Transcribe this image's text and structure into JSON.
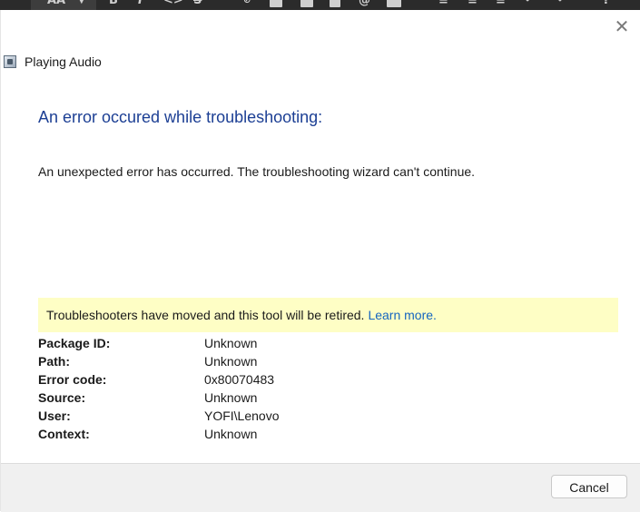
{
  "dialog": {
    "title": "Playing Audio",
    "close_glyph": "✕",
    "heading": "An error occured while troubleshooting:",
    "message": "An unexpected error has occurred. The troubleshooting wizard can't continue.",
    "notice": {
      "text": "Troubleshooters have moved and this tool will be retired.",
      "link": "Learn more."
    },
    "details": [
      {
        "label": "Package ID:",
        "value": "Unknown"
      },
      {
        "label": "Path:",
        "value": "Unknown"
      },
      {
        "label": "Error code:",
        "value": "0x80070483"
      },
      {
        "label": "Source:",
        "value": "Unknown"
      },
      {
        "label": "User:",
        "value": "YOFI\\Lenovo"
      },
      {
        "label": "Context:",
        "value": "Unknown"
      }
    ],
    "cancel_label": "Cancel"
  },
  "icons": {
    "app_icon": "troubleshooter-app-icon",
    "close": "close-icon"
  },
  "colors": {
    "heading": "#1c3f94",
    "notice_bg": "#fefec5",
    "link": "#1565c0",
    "footer_bg": "#f0f0f0"
  }
}
